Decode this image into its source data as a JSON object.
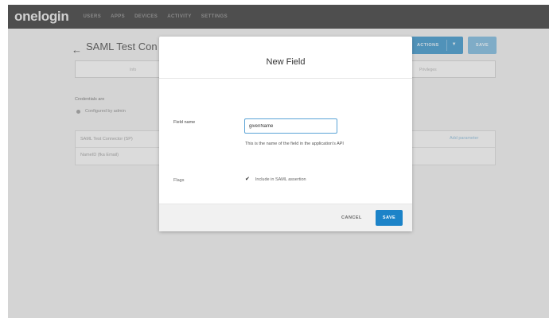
{
  "brand": {
    "logo_text": "onelogin"
  },
  "nav": {
    "items": [
      {
        "label": "USERS"
      },
      {
        "label": "APPS"
      },
      {
        "label": "DEVICES"
      },
      {
        "label": "ACTIVITY"
      },
      {
        "label": "SETTINGS"
      }
    ]
  },
  "page": {
    "title": "SAML Test Con",
    "more_actions_label": "ACTIONS",
    "save_label": "SAVE",
    "tabs": [
      {
        "label": "Info"
      },
      {
        "label": "Privileges"
      }
    ],
    "credentials_label": "Credentials are",
    "credentials_option": "Configured by admin",
    "params_header": "SAML Test Connector (SP)",
    "params_row": "NameID (fka Email)",
    "add_parameter_label": "Add parameter"
  },
  "modal": {
    "title": "New Field",
    "field_name_label": "Field name",
    "field_name_value": "givenName",
    "help_text": "This is the name of the field in the application's API",
    "flags_label": "Flags",
    "include_saml_label": "Include in SAML assertion",
    "include_saml_checked": true,
    "cancel_label": "CANCEL",
    "save_label": "SAVE"
  },
  "colors": {
    "primary": "#1c83c8",
    "nav_bg": "#575757"
  }
}
